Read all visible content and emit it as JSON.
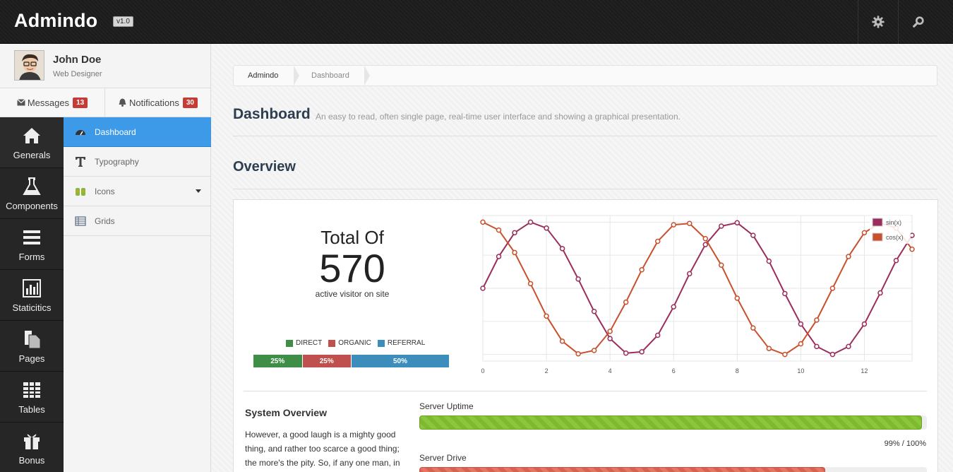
{
  "app": {
    "brand": "Admindo",
    "version": "v1.0"
  },
  "topbar": {
    "icons": [
      "gear-icon",
      "search-icon"
    ]
  },
  "profile": {
    "name": "John Doe",
    "role": "Web Designer"
  },
  "messages": {
    "label": "Messages",
    "count": "13"
  },
  "notifications": {
    "label": "Notifications",
    "count": "30"
  },
  "nav": {
    "items": [
      {
        "label": "Generals",
        "icon": "home-icon"
      },
      {
        "label": "Components",
        "icon": "flask-icon"
      },
      {
        "label": "Forms",
        "icon": "list-icon"
      },
      {
        "label": "Staticitics",
        "icon": "bar-chart-icon"
      },
      {
        "label": "Pages",
        "icon": "pages-icon"
      },
      {
        "label": "Tables",
        "icon": "table-icon"
      },
      {
        "label": "Bonus",
        "icon": "gift-icon"
      }
    ]
  },
  "submenu": {
    "items": [
      {
        "label": "Dashboard",
        "icon": "dashboard-icon",
        "active": true
      },
      {
        "label": "Typography",
        "icon": "typography-icon"
      },
      {
        "label": "Icons",
        "icon": "icons-icon"
      },
      {
        "label": "Grids",
        "icon": "grid-icon"
      }
    ]
  },
  "breadcrumb": [
    "Admindo",
    "Dashboard"
  ],
  "page": {
    "title": "Dashboard",
    "subtitle": "An easy to read, often single page, real-time user interface and showing a graphical presentation.",
    "section": "Overview"
  },
  "stats": {
    "total_label": "Total Of",
    "total_value": "570",
    "caption": "active visitor on site",
    "legend": [
      {
        "label": "DIRECT",
        "color": "#3e8e48"
      },
      {
        "label": "ORGANIC",
        "color": "#c0504d"
      },
      {
        "label": "REFERRAL",
        "color": "#3c8dbc"
      }
    ],
    "segments": [
      {
        "label": "25%",
        "value": 25,
        "color": "#3e8e48"
      },
      {
        "label": "25%",
        "value": 25,
        "color": "#c0504d"
      },
      {
        "label": "50%",
        "value": 50,
        "color": "#3c8dbc"
      }
    ]
  },
  "chart_data": {
    "type": "line",
    "title": "",
    "xlabel": "",
    "ylabel": "",
    "xlim": [
      0,
      13.5
    ],
    "ylim": [
      -1.1,
      1.1
    ],
    "xticks": [
      "0",
      "2",
      "4",
      "6",
      "8",
      "10",
      "12"
    ],
    "yticks": [
      "1.0",
      "0.5",
      "0.0",
      "-0.5",
      "-1.0"
    ],
    "grid": true,
    "legend_position": "top-right",
    "x": [
      0,
      0.5,
      1,
      1.5,
      2,
      2.5,
      3,
      3.5,
      4,
      4.5,
      5,
      5.5,
      6,
      6.5,
      7,
      7.5,
      8,
      8.5,
      9,
      9.5,
      10,
      10.5,
      11,
      11.5,
      12,
      12.5,
      13,
      13.5
    ],
    "series": [
      {
        "name": "sin(x)",
        "color": "#9b2d5c",
        "values": [
          0.0,
          0.48,
          0.84,
          1.0,
          0.91,
          0.6,
          0.14,
          -0.35,
          -0.76,
          -0.98,
          -0.96,
          -0.71,
          -0.28,
          0.22,
          0.66,
          0.94,
          0.99,
          0.8,
          0.41,
          -0.08,
          -0.54,
          -0.88,
          -1.0,
          -0.88,
          -0.54,
          -0.07,
          0.42,
          0.8
        ]
      },
      {
        "name": "cos(x)",
        "color": "#c8502d",
        "values": [
          1.0,
          0.88,
          0.54,
          0.07,
          -0.42,
          -0.8,
          -0.99,
          -0.94,
          -0.65,
          -0.21,
          0.28,
          0.71,
          0.96,
          0.98,
          0.75,
          0.35,
          -0.15,
          -0.6,
          -0.91,
          -1.0,
          -0.84,
          -0.48,
          0.0,
          0.48,
          0.84,
          0.99,
          0.91,
          0.59
        ]
      }
    ]
  },
  "system": {
    "title": "System Overview",
    "text": "However, a good laugh is a mighty good thing, and rather too scarce a good thing; the more's the pity. So, if any one man, in",
    "uptime_label": "Server Uptime",
    "uptime_value": 0.99,
    "uptime_text": "99% / 100%",
    "drive_label": "Server Drive",
    "drive_value": 0.8
  }
}
